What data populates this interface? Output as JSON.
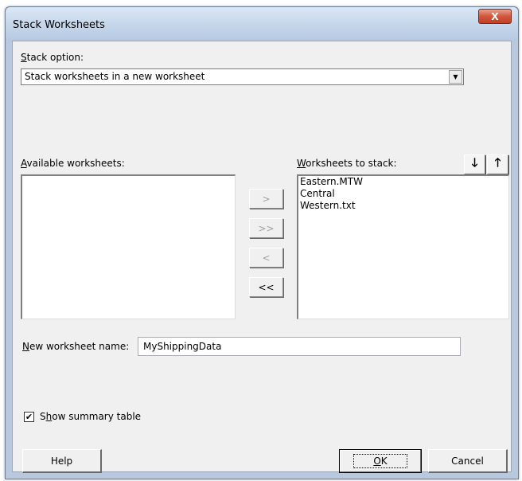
{
  "window": {
    "title": "Stack Worksheets",
    "close_glyph": "X"
  },
  "stack_option": {
    "label_accel": "S",
    "label_rest": "tack option:",
    "selected": "Stack worksheets in a new worksheet"
  },
  "available": {
    "label_accel": "A",
    "label_rest": "vailable worksheets:",
    "items": []
  },
  "to_stack": {
    "label_accel": "W",
    "label_rest": "orksheets to stack:",
    "items": [
      "Eastern.MTW",
      "Central",
      "Western.txt"
    ]
  },
  "move_buttons": {
    "add": ">",
    "add_all": ">>",
    "remove": "<",
    "remove_all": "<<"
  },
  "order_buttons": {
    "down": "🡓",
    "up": "🡑"
  },
  "new_name": {
    "label_accel": "N",
    "label_rest": "ew worksheet name:",
    "value": "MyShippingData"
  },
  "summary": {
    "label_pre": "S",
    "label_accel": "h",
    "label_rest": "ow summary table",
    "checked": true,
    "check_glyph": "✔"
  },
  "buttons": {
    "help": "Help",
    "ok_accel": "O",
    "ok_rest": "K",
    "cancel": "Cancel"
  }
}
